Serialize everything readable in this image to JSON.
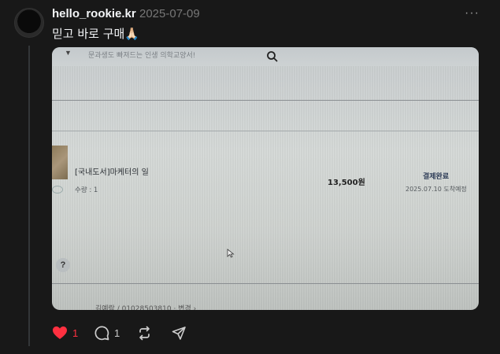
{
  "post": {
    "username": "hello_rookie.kr",
    "date": "2025-07-09",
    "caption": "믿고 바로 구매🙏🏻",
    "more_icon": "more-icon"
  },
  "photo": {
    "search_placeholder": "문과생도 빠져드는 인생 의학교양서!",
    "order": {
      "title": "[국내도서]마케터의 일",
      "quantity": "수량 : 1",
      "price": "13,500원",
      "status": "결제완료",
      "eta": "2025.07.10 도착예정"
    },
    "help_label": "?",
    "bottom_text": "김예람 / 01028503810 · 변경 ›"
  },
  "actions": {
    "like_count": "1",
    "comment_count": "1",
    "like_color": "#ff3040"
  }
}
